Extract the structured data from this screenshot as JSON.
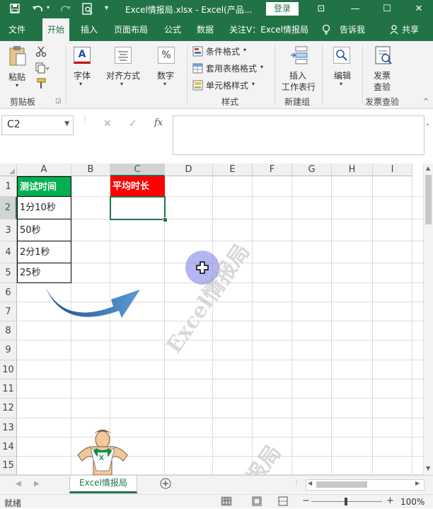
{
  "window": {
    "title": "Excel情报局.xlsx  -  Excel(产品...",
    "login_label": "登录",
    "save_icon": "save-icon",
    "undo_icon": "undo-icon",
    "redo_icon": "redo-icon",
    "min_symbol": "—",
    "max_symbol": "☐",
    "close_symbol": "✕",
    "ribbon_opts_symbol": "⊡"
  },
  "tabs": [
    {
      "label": "文件"
    },
    {
      "label": "开始"
    },
    {
      "label": "插入"
    },
    {
      "label": "页面布局"
    },
    {
      "label": "公式"
    },
    {
      "label": "数据"
    },
    {
      "label": "关注V：Excel情报局"
    },
    {
      "label": "告诉我"
    },
    {
      "label": "共享"
    }
  ],
  "ribbon": {
    "paste": "粘贴",
    "font": "字体",
    "align": "对齐方式",
    "number": "数字",
    "number_symbol": "%",
    "cond_format": "条件格式",
    "table_format": "套用表格格式",
    "cell_style": "单元格样式",
    "insert_line1": "插入",
    "insert_line2": "工作表行",
    "edit": "编辑",
    "invoice_line1": "发票",
    "invoice_line2": "查验",
    "groups": {
      "clipboard": "剪贴板",
      "styles": "样式",
      "new_group": "新建组",
      "invoice": "发票查验"
    }
  },
  "formula_bar": {
    "name_box": "C2",
    "cancel": "✕",
    "confirm": "✓",
    "fx": "fx",
    "content": ""
  },
  "grid": {
    "columns": [
      "A",
      "B",
      "C",
      "D",
      "E",
      "F",
      "G",
      "H",
      "I"
    ],
    "rows": [
      "1",
      "2",
      "3",
      "4",
      "5",
      "6",
      "7",
      "8",
      "9",
      "10",
      "11",
      "12",
      "13",
      "14",
      "15"
    ],
    "A1": "测试时间",
    "A2": "1分10秒",
    "A3": "50秒",
    "A4": "2分1秒",
    "A5": "25秒",
    "C1": "平均时长",
    "selected_cell": "C2",
    "watermark": "Excel情报局",
    "watermark2": "报局",
    "header_green": "#00B050",
    "header_red": "#FF0000"
  },
  "sheets": [
    {
      "name": "Excel情报局"
    }
  ],
  "status": {
    "ready": "就绪",
    "zoom": "100%",
    "zoom_minus": "−",
    "zoom_plus": "+"
  }
}
